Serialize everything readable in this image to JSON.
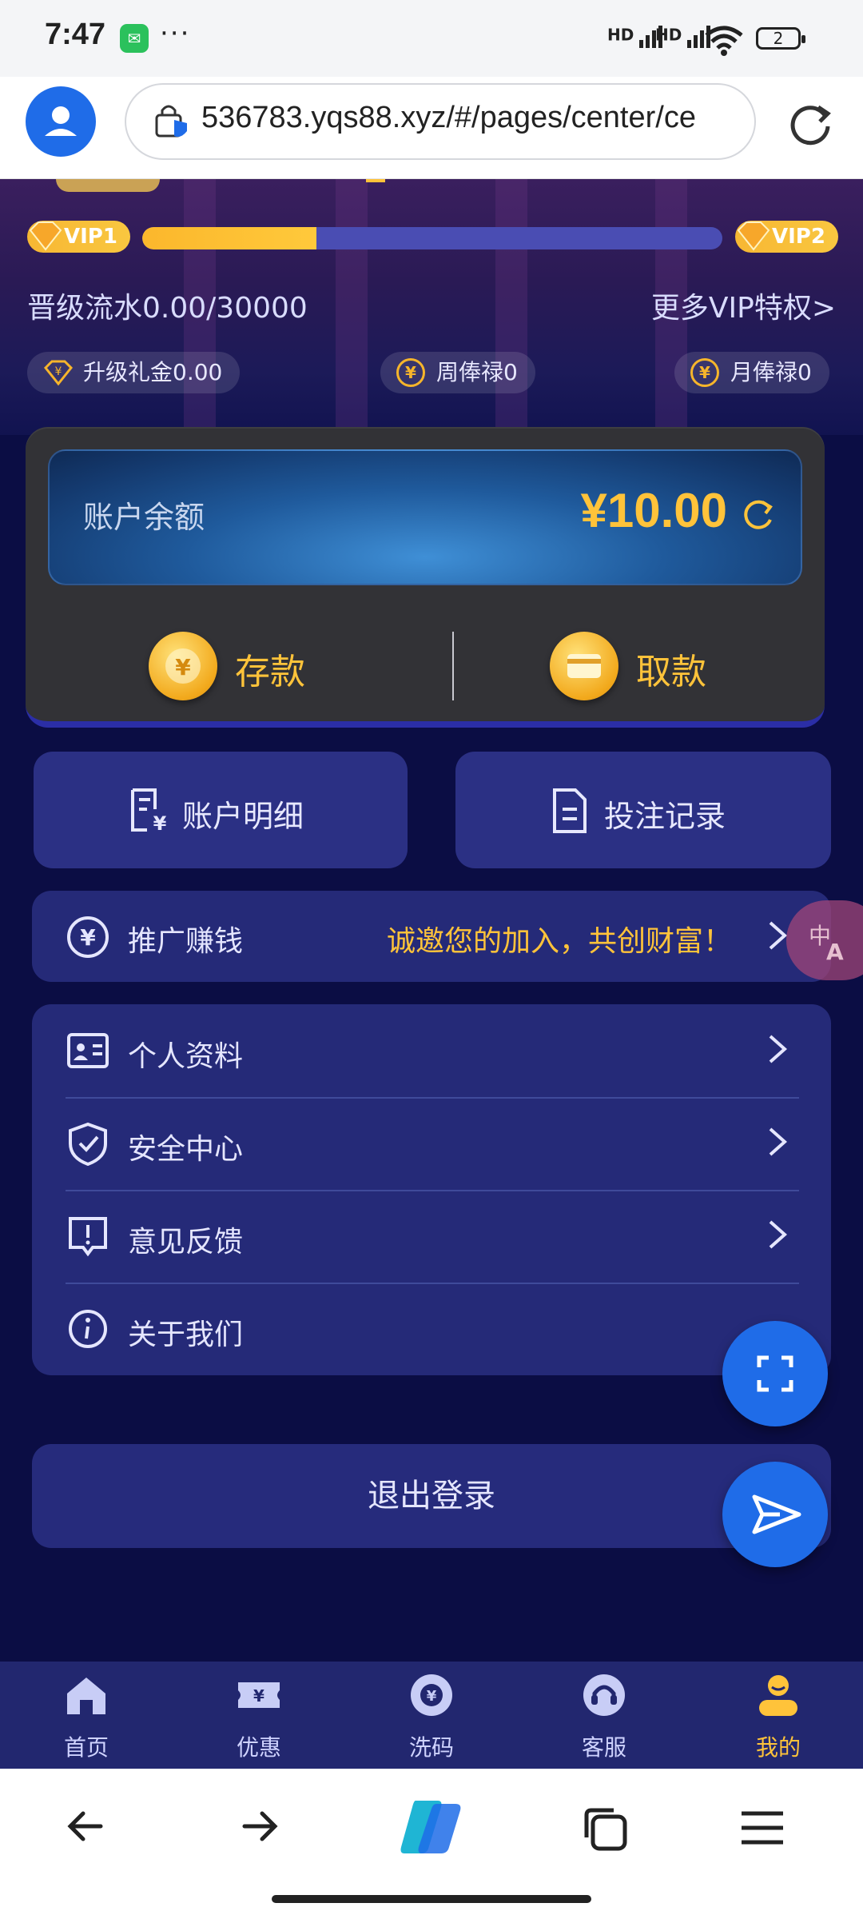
{
  "status_bar": {
    "time": "7:47",
    "battery": "2",
    "signal1": "HD",
    "signal2": "HD"
  },
  "browser": {
    "url": "536783.yqs88.xyz/#/pages/center/ce"
  },
  "vip": {
    "current_level": "VIP1",
    "next_level": "VIP2",
    "progress": 0.3,
    "upgrade_flow": "晋级流水0.00/30000",
    "more_vip": "更多VIP特权>",
    "upgrade_bonus": "升级礼金0.00",
    "weekly_salary": "周俸禄0",
    "monthly_salary": "月俸禄0"
  },
  "balance": {
    "label": "账户余额",
    "amount": "¥10.00",
    "deposit": "存款",
    "withdraw": "取款"
  },
  "tiles": {
    "account_details": "账户明细",
    "bet_records": "投注记录"
  },
  "promo": {
    "label": "推广赚钱",
    "slogan": "诚邀您的加入，共创财富！"
  },
  "menu": {
    "profile": "个人资料",
    "security": "安全中心",
    "feedback": "意见反馈",
    "about": "关于我们"
  },
  "logout": "退出登录",
  "tabs": [
    {
      "label": "首页"
    },
    {
      "label": "优惠"
    },
    {
      "label": "洗码"
    },
    {
      "label": "客服"
    },
    {
      "label": "我的"
    }
  ],
  "colors": {
    "accent": "#ffc33a",
    "background": "#0b0d44",
    "browser_blue": "#1f6ce8"
  }
}
